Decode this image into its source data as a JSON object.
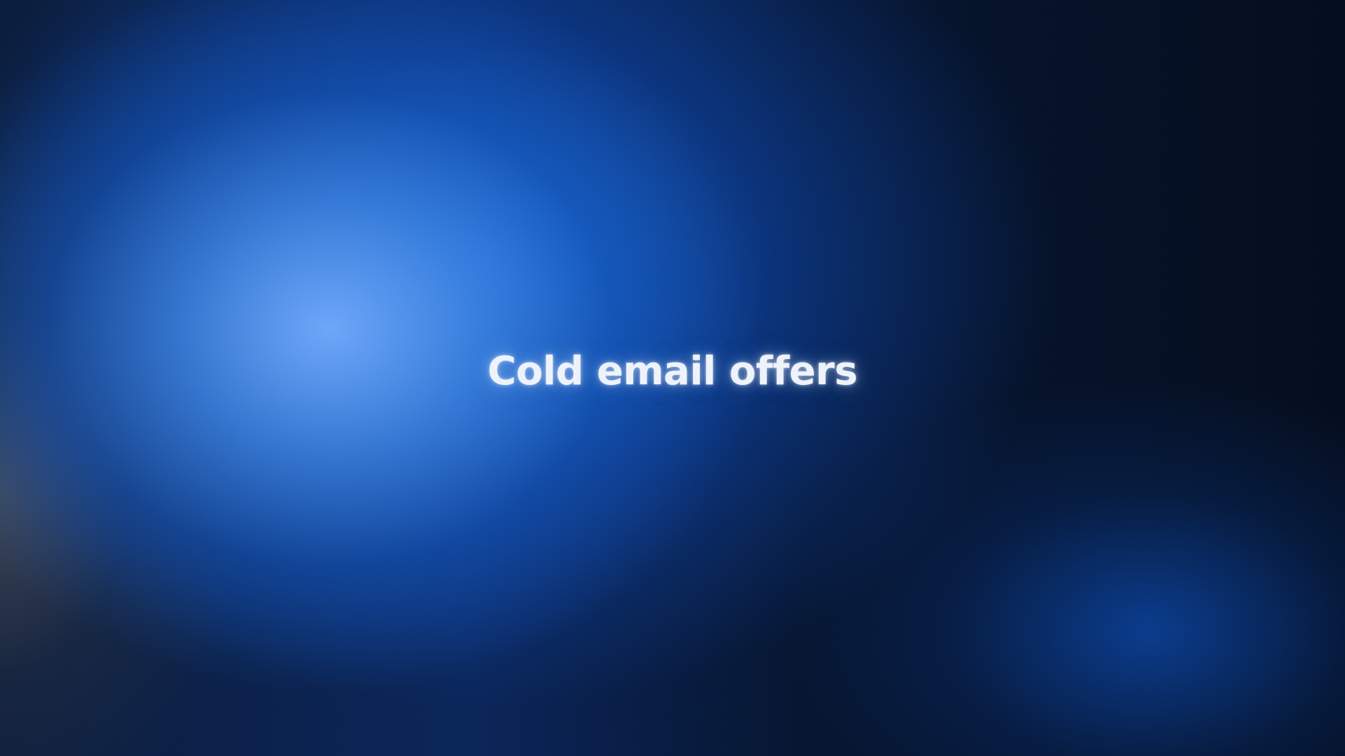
{
  "slide": {
    "title": "Cold email offers"
  },
  "colors": {
    "background_dark": "#061226",
    "glow_blue": "#6ea8ff",
    "text": "#eef3fb"
  }
}
